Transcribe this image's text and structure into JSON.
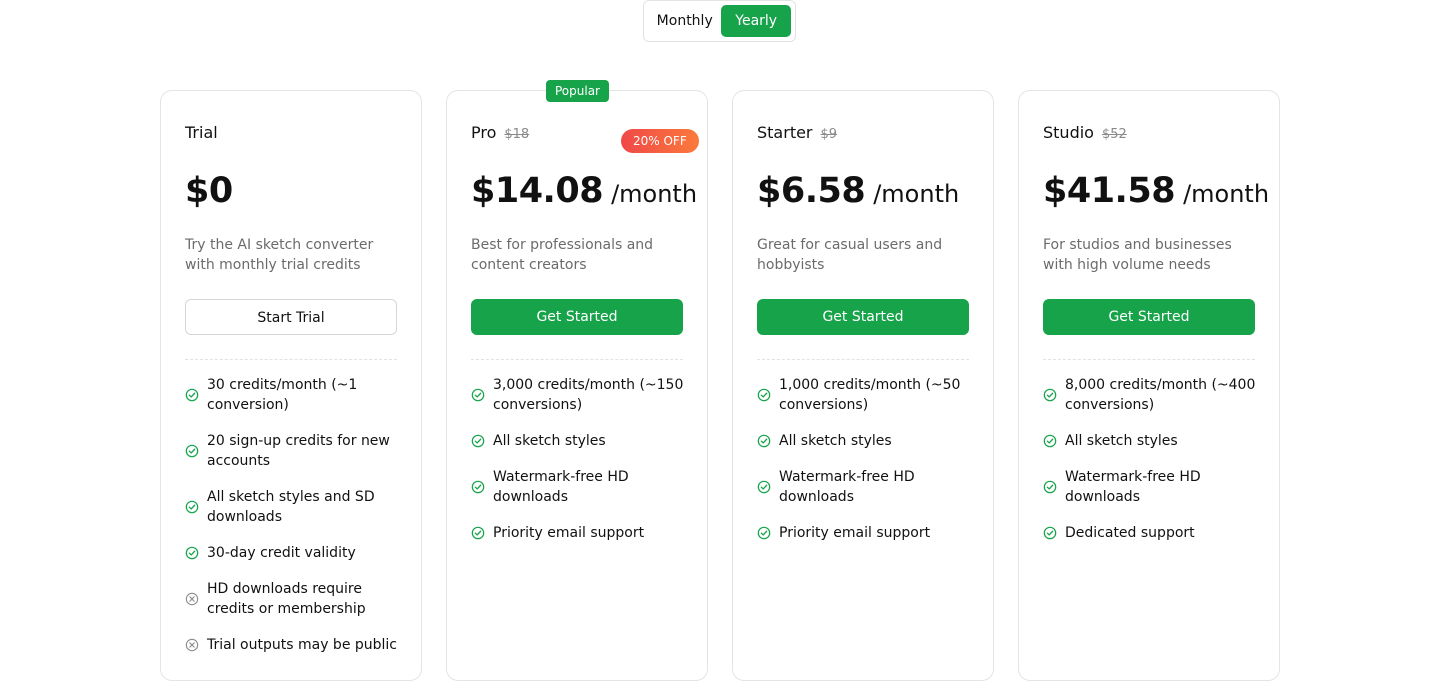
{
  "billing_toggle": {
    "monthly_label": "Monthly",
    "yearly_label": "Yearly",
    "selected": "Yearly"
  },
  "colors": {
    "accent": "#16a34a",
    "badge_gradient_start": "#f04848",
    "badge_gradient_end": "#fb7a3c"
  },
  "plans": [
    {
      "name": "Trial",
      "old_price": "",
      "price": "$0",
      "unit": "",
      "description": "Try the AI sketch converter with monthly trial credits",
      "cta": "Start Trial",
      "features": [
        {
          "text": "30 credits/month (~1 conversion)",
          "icon": "check-circle-icon",
          "included": true
        },
        {
          "text": "20 sign-up credits for new accounts",
          "icon": "check-circle-icon",
          "included": true
        },
        {
          "text": "All sketch styles and SD downloads",
          "icon": "check-circle-icon",
          "included": true
        },
        {
          "text": "30-day credit validity",
          "icon": "check-circle-icon",
          "included": true
        },
        {
          "text": "HD downloads require credits or membership",
          "icon": "x-circle-icon",
          "included": false
        },
        {
          "text": "Trial outputs may be public",
          "icon": "x-circle-icon",
          "included": false
        }
      ]
    },
    {
      "name": "Pro",
      "old_price": "$18",
      "price": "$14.08",
      "unit": "/month",
      "badge": "Popular",
      "discount": "20% OFF",
      "description": "Best for professionals and content creators",
      "cta": "Get Started",
      "features": [
        {
          "text": "3,000 credits/month (~150 conversions)",
          "icon": "check-circle-icon",
          "included": true
        },
        {
          "text": "All sketch styles",
          "icon": "check-circle-icon",
          "included": true
        },
        {
          "text": "Watermark-free HD downloads",
          "icon": "check-circle-icon",
          "included": true
        },
        {
          "text": "Priority email support",
          "icon": "check-circle-icon",
          "included": true
        }
      ]
    },
    {
      "name": "Starter",
      "old_price": "$9",
      "price": "$6.58",
      "unit": "/month",
      "description": "Great for casual users and hobbyists",
      "cta": "Get Started",
      "features": [
        {
          "text": "1,000 credits/month (~50 conversions)",
          "icon": "check-circle-icon",
          "included": true
        },
        {
          "text": "All sketch styles",
          "icon": "check-circle-icon",
          "included": true
        },
        {
          "text": "Watermark-free HD downloads",
          "icon": "check-circle-icon",
          "included": true
        },
        {
          "text": "Priority email support",
          "icon": "check-circle-icon",
          "included": true
        }
      ]
    },
    {
      "name": "Studio",
      "old_price": "$52",
      "price": "$41.58",
      "unit": "/month",
      "description": "For studios and businesses with high volume needs",
      "cta": "Get Started",
      "features": [
        {
          "text": "8,000 credits/month (~400 conversions)",
          "icon": "check-circle-icon",
          "included": true
        },
        {
          "text": "All sketch styles",
          "icon": "check-circle-icon",
          "included": true
        },
        {
          "text": "Watermark-free HD downloads",
          "icon": "check-circle-icon",
          "included": true
        },
        {
          "text": "Dedicated support",
          "icon": "check-circle-icon",
          "included": true
        }
      ]
    }
  ]
}
